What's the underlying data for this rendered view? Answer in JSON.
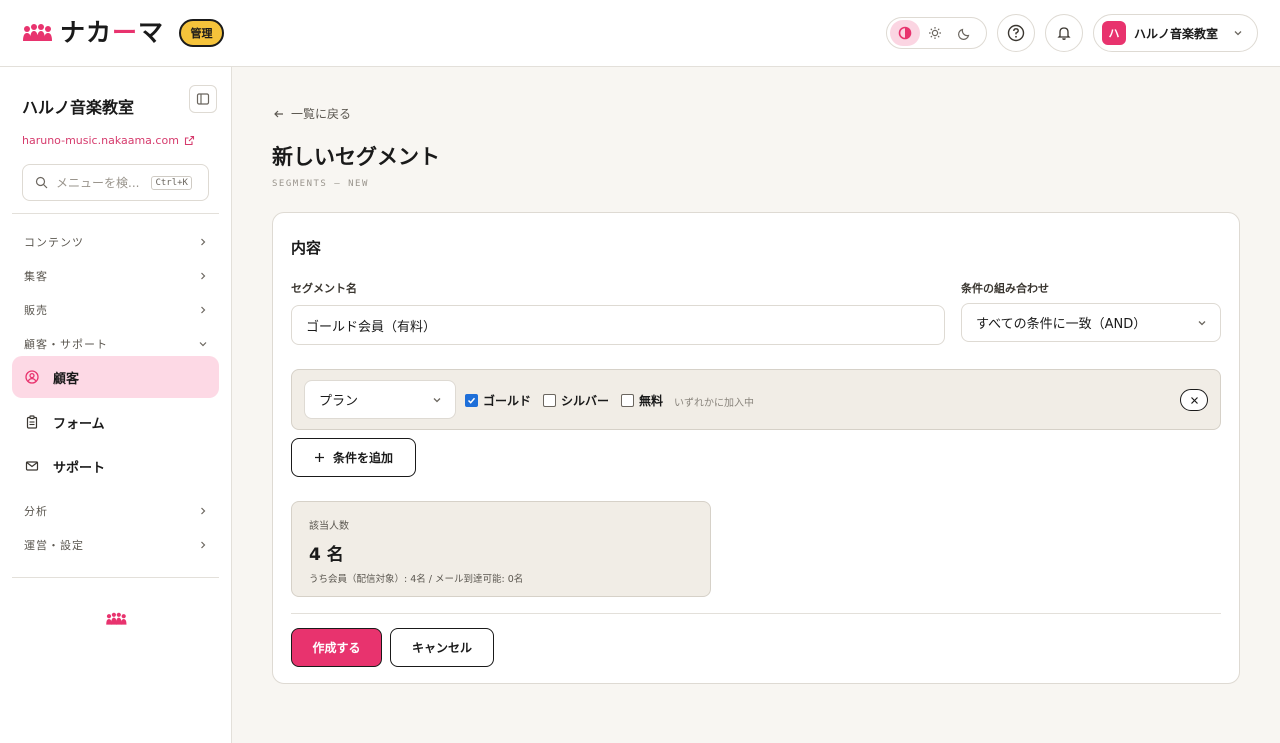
{
  "brand": {
    "logo_text_a": "ナカ",
    "logo_text_b": "ー",
    "logo_text_c": "マ",
    "admin_badge": "管理",
    "accent_color": "#e8336e"
  },
  "header": {
    "theme_options": [
      "contrast-icon",
      "sun-icon",
      "moon-icon"
    ],
    "active_theme": "contrast",
    "user": {
      "avatar_initial": "ハ",
      "name": "ハルノ音楽教室"
    }
  },
  "sidebar": {
    "org_name": "ハルノ音楽教室",
    "org_url": "haruno-music.nakaama.com",
    "search": {
      "placeholder": "メニューを検...",
      "shortcut": "Ctrl+K"
    },
    "sections": [
      {
        "label": "コンテンツ",
        "expanded": false
      },
      {
        "label": "集客",
        "expanded": false
      },
      {
        "label": "販売",
        "expanded": false
      },
      {
        "label": "顧客・サポート",
        "expanded": true
      }
    ],
    "items": [
      {
        "label": "顧客",
        "icon": "user-circle-icon",
        "active": true
      },
      {
        "label": "フォーム",
        "icon": "clipboard-icon",
        "active": false
      },
      {
        "label": "サポート",
        "icon": "mail-icon",
        "active": false
      }
    ],
    "sections_after": [
      {
        "label": "分析",
        "expanded": false
      },
      {
        "label": "運営・設定",
        "expanded": false
      }
    ]
  },
  "main": {
    "back_label": "一覧に戻る",
    "title": "新しいセグメント",
    "subtitle": "SEGMENTS — NEW",
    "card": {
      "title": "内容",
      "name_label": "セグメント名",
      "name_value": "ゴールド会員（有料）",
      "combine_label": "条件の組み合わせ",
      "combine_value": "すべての条件に一致（AND）",
      "condition": {
        "field": "プラン",
        "options": [
          {
            "label": "ゴールド",
            "checked": true
          },
          {
            "label": "シルバー",
            "checked": false
          },
          {
            "label": "無料",
            "checked": false
          }
        ],
        "hint": "いずれかに加入中"
      },
      "add_condition_label": "条件を追加",
      "count": {
        "label": "該当人数",
        "value": "4 名",
        "detail": "うち会員（配信対象）: 4名 / メール到達可能: 0名"
      },
      "submit_label": "作成する",
      "cancel_label": "キャンセル"
    }
  }
}
